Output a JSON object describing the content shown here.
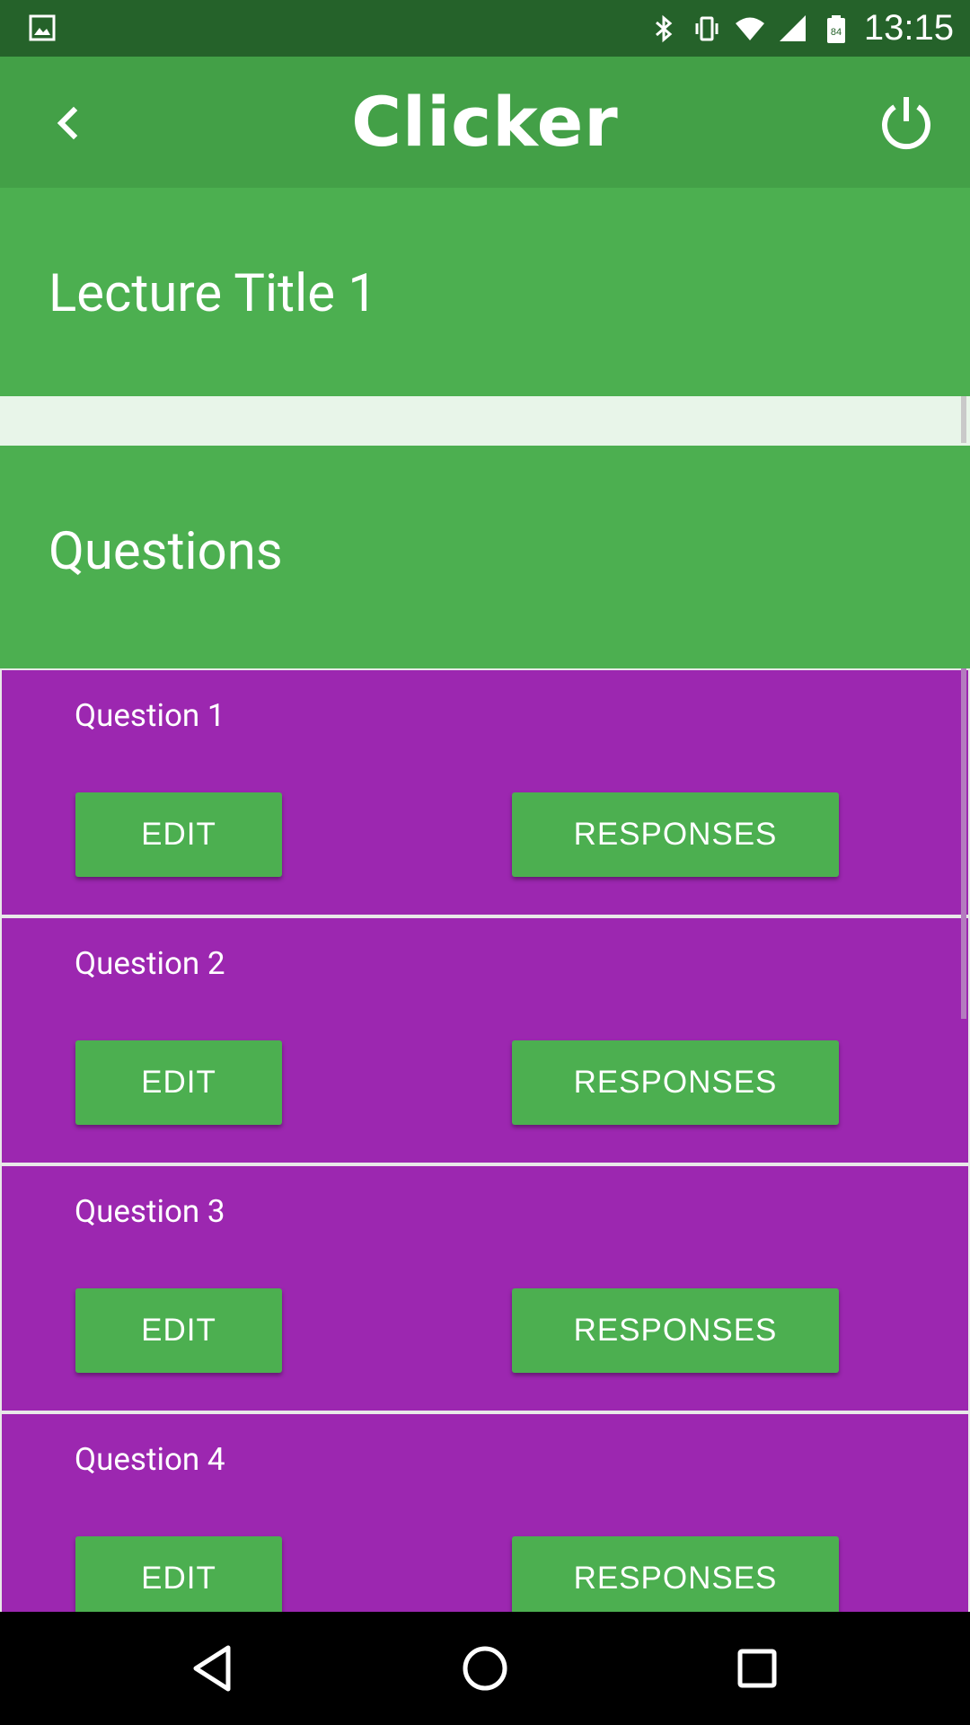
{
  "status_bar": {
    "time": "13:15",
    "battery_level": "84",
    "icons": [
      "image-icon",
      "bluetooth-icon",
      "vibrate-icon",
      "wifi-icon",
      "signal-icon",
      "battery-icon"
    ]
  },
  "app_bar": {
    "title": "Clicker",
    "back_icon": "chevron-left-icon",
    "power_icon": "power-icon"
  },
  "lecture": {
    "title": "Lecture Title 1"
  },
  "questions_section": {
    "label": "Questions",
    "items": [
      {
        "title": "Question 1",
        "edit_label": "EDIT",
        "responses_label": "RESPONSES"
      },
      {
        "title": "Question 2",
        "edit_label": "EDIT",
        "responses_label": "RESPONSES"
      },
      {
        "title": "Question 3",
        "edit_label": "EDIT",
        "responses_label": "RESPONSES"
      },
      {
        "title": "Question 4",
        "edit_label": "EDIT",
        "responses_label": "RESPONSES"
      }
    ]
  },
  "nav_bar": {
    "icons": [
      "back-triangle-icon",
      "home-circle-icon",
      "recents-square-icon"
    ]
  },
  "colors": {
    "status_bar": "#25622a",
    "app_bar": "#43a047",
    "section": "#4caf50",
    "question_item": "#9c27b0",
    "button": "#4caf50",
    "background": "#e8f5e9"
  }
}
